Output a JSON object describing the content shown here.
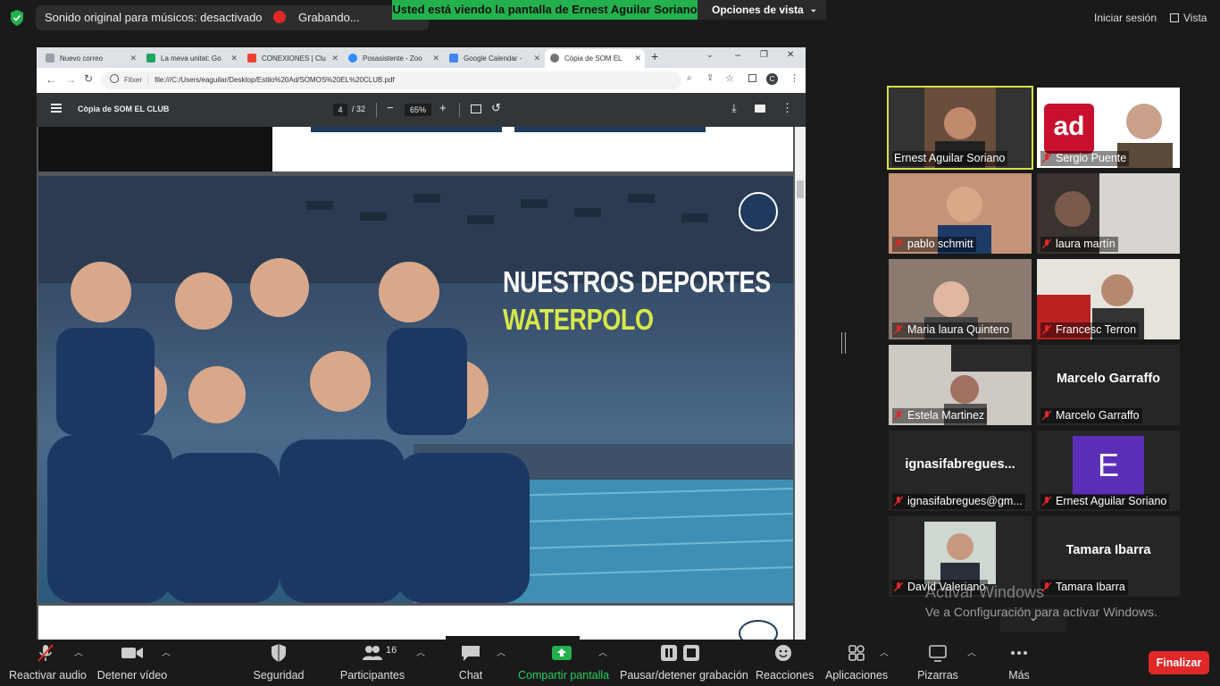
{
  "topbar": {
    "original_sound": "Sonido original para músicos: desactivado",
    "recording": "Grabando...",
    "viewing_banner": "Usted está viendo la pantalla de Ernest Aguilar Soriano",
    "view_options": "Opciones de vista",
    "sign_in": "Iniciar sesión",
    "view": "Vista"
  },
  "browser": {
    "tabs": [
      {
        "label": "Nuevo correo",
        "color": "#5f6368"
      },
      {
        "label": "La meva unitat: Go",
        "color": "#1fa463"
      },
      {
        "label": "CONEXIONES | Clu",
        "color": "#ea4335"
      },
      {
        "label": "Posasistente - Zoo",
        "color": "#2d8cff"
      },
      {
        "label": "Google Calendar -",
        "color": "#4285f4"
      },
      {
        "label": "Còpia de SOM EL",
        "color": "#5f6368"
      }
    ],
    "url_label": "Fitxer",
    "url": "file:///C:/Users/eaguilar/Desktop/Estilo%20Ad/SOMOS%20EL%20CLUB.pdf",
    "profile_initial": "C"
  },
  "pdf": {
    "title": "Còpia de SOM EL CLUB",
    "page_current": "4",
    "page_total": "/ 32",
    "zoom": "65%",
    "heading_line1": "NUESTROS DEPORTES",
    "heading_line2": "WATERPOLO",
    "accent_color": "#d6e84a"
  },
  "participants": [
    {
      "name": "Ernest Aguilar Soriano",
      "type": "video",
      "muted": false,
      "active": true
    },
    {
      "name": "Sergio Puente",
      "type": "video",
      "muted": true
    },
    {
      "name": "pablo schmitt",
      "type": "video",
      "muted": true
    },
    {
      "name": "laura martín",
      "type": "video",
      "muted": true
    },
    {
      "name": "Maria laura Quintero",
      "type": "video",
      "muted": true
    },
    {
      "name": "Francesc Terron",
      "type": "video",
      "muted": true
    },
    {
      "name": "Estela Martinez",
      "type": "video",
      "muted": true
    },
    {
      "name": "Marcelo Garraffo",
      "type": "name",
      "big": "Marcelo Garraffo",
      "muted": true
    },
    {
      "name": "ignasifabregues@gm...",
      "type": "name",
      "big": "ignasifabregues...",
      "muted": true
    },
    {
      "name": "Ernest Aguilar Soriano",
      "type": "avatar",
      "initial": "E",
      "muted": true
    },
    {
      "name": "David Valeriano",
      "type": "photo",
      "muted": true
    },
    {
      "name": "Tamara Ibarra",
      "type": "name",
      "big": "Tamara Ibarra",
      "muted": true
    }
  ],
  "watermark": {
    "line1": "Activar Windows",
    "line2": "Ve a Configuración para activar Windows."
  },
  "toolbar": {
    "unmute": "Reactivar audio",
    "stop_video": "Detener vídeo",
    "security": "Seguridad",
    "participants": "Participantes",
    "participants_count": "16",
    "chat": "Chat",
    "share": "Compartir pantalla",
    "pause_record": "Pausar/detener grabación",
    "reactions": "Reacciones",
    "apps": "Aplicaciones",
    "whiteboards": "Pizarras",
    "more": "Más",
    "end": "Finalizar"
  }
}
